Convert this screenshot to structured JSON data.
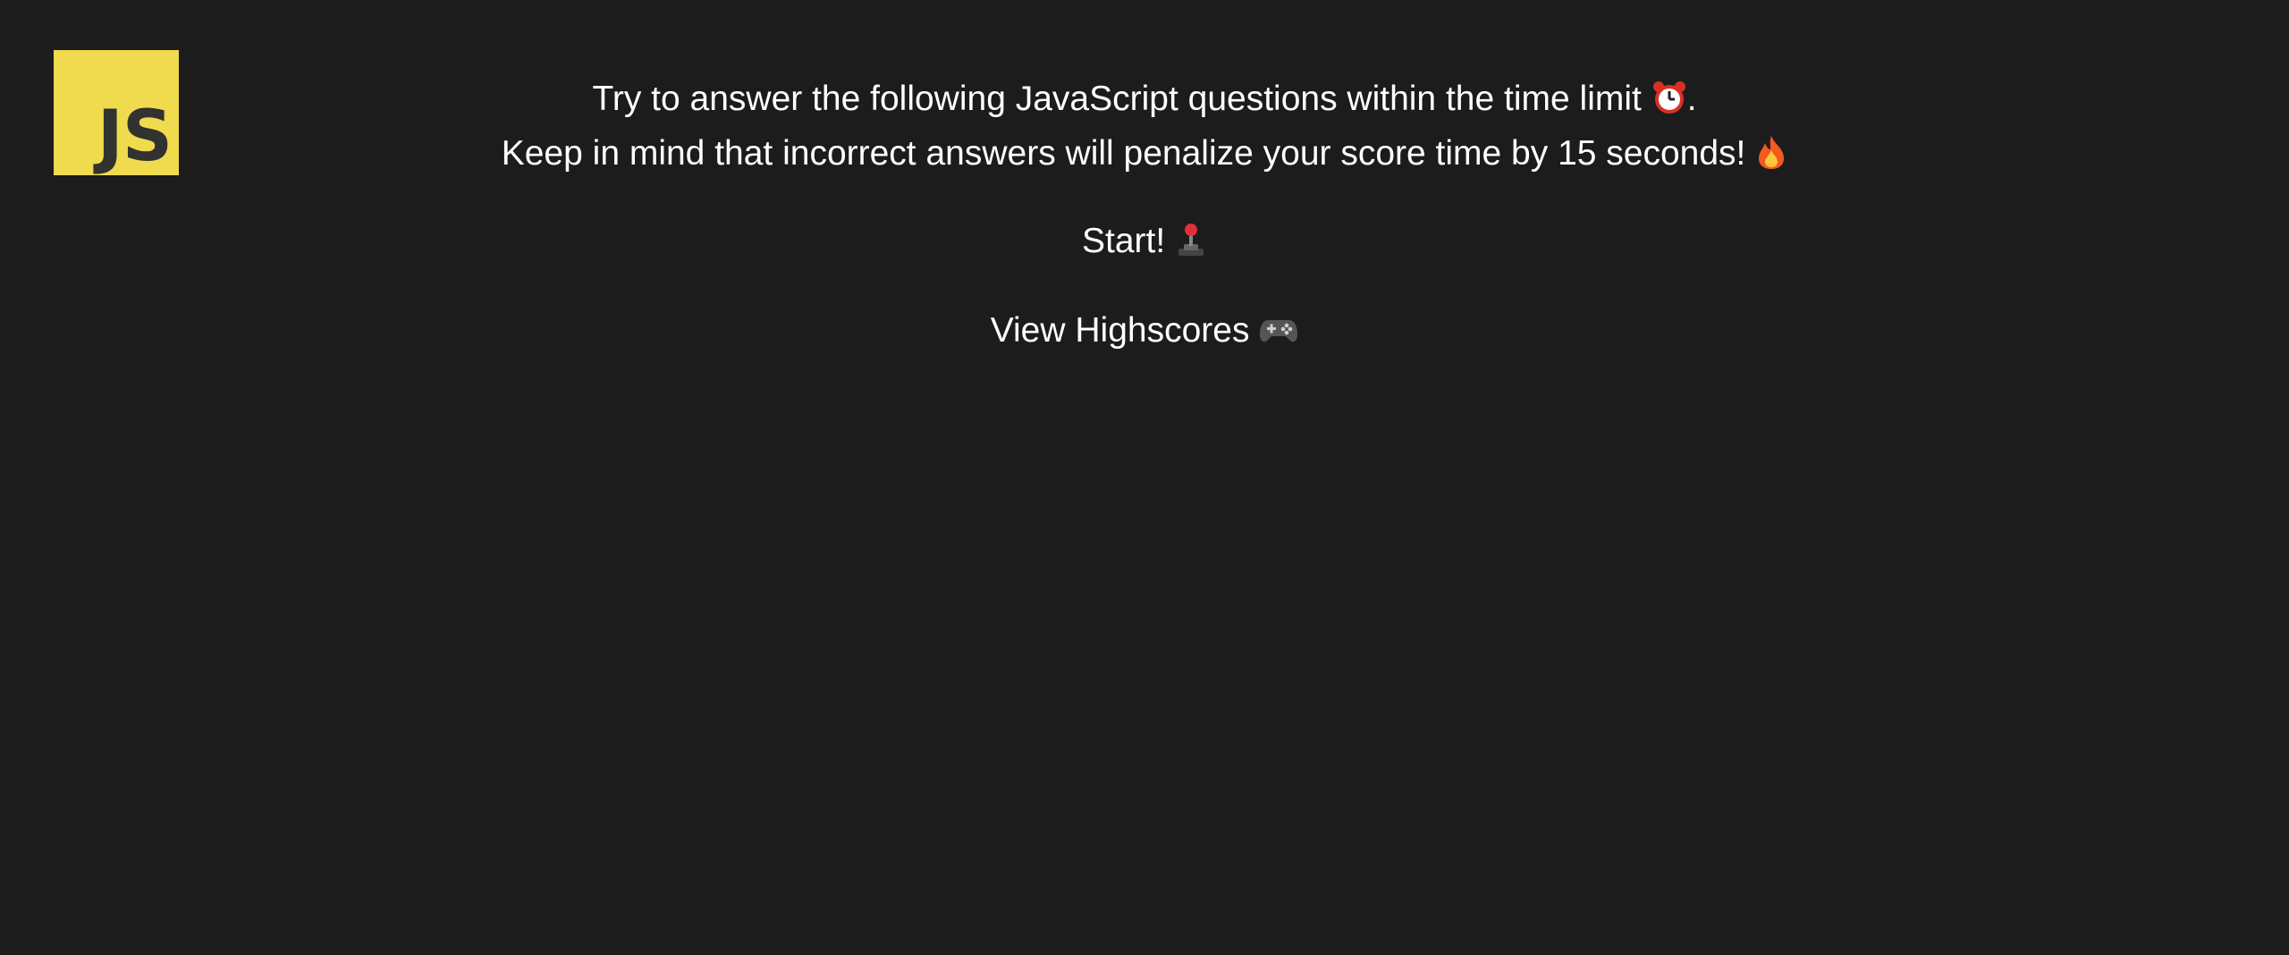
{
  "logo": {
    "text": "JS",
    "background": "#f0db4f",
    "text_color": "#323330"
  },
  "instructions": {
    "line1": "Try to answer the following JavaScript questions within the time limit",
    "line1_icon": "alarm-clock-icon",
    "line1_end": ".",
    "line2": "Keep in mind that incorrect answers will penalize your score time by 15 seconds!",
    "line2_icon": "fire-icon"
  },
  "start_button": {
    "label": "Start!",
    "icon": "joystick-icon"
  },
  "highscores_button": {
    "label": "View Highscores",
    "icon": "game-controller-icon"
  },
  "colors": {
    "background": "#1c1c1c",
    "text": "#ffffff"
  }
}
